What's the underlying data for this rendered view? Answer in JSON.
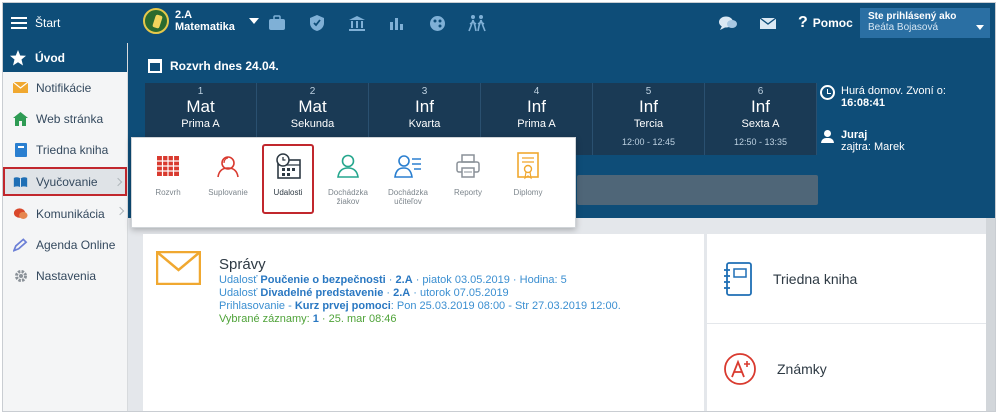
{
  "topbar": {
    "start_label": "Štart",
    "class_name": "2.A",
    "subject_name": "Matematika",
    "help_label": "Pomoc",
    "user_line1": "Ste prihlásený ako",
    "user_line2": "Beáta Bojasová"
  },
  "sidebar": {
    "uvod": "Úvod",
    "items": [
      {
        "label": "Notifikácie",
        "icon": "envelope-icon"
      },
      {
        "label": "Web stránka",
        "icon": "home-icon"
      },
      {
        "label": "Triedna kniha",
        "icon": "book-icon"
      },
      {
        "label": "Vyučovanie",
        "icon": "open-book-icon"
      },
      {
        "label": "Komunikácia",
        "icon": "chat-icon"
      },
      {
        "label": "Agenda Online",
        "icon": "pen-icon"
      },
      {
        "label": "Nastavenia",
        "icon": "gear-icon"
      }
    ]
  },
  "schedule": {
    "title": "Rozvrh dnes 24.04.",
    "periods": [
      {
        "num": "1",
        "subject": "Mat",
        "cls": "Prima A",
        "time": ""
      },
      {
        "num": "2",
        "subject": "Mat",
        "cls": "Sekunda",
        "time": ""
      },
      {
        "num": "3",
        "subject": "Inf",
        "cls": "Kvarta",
        "time": ""
      },
      {
        "num": "4",
        "subject": "Inf",
        "cls": "Prima A",
        "time": ""
      },
      {
        "num": "5",
        "subject": "Inf",
        "cls": "Tercia",
        "time": "12:00 - 12:45"
      },
      {
        "num": "6",
        "subject": "Inf",
        "cls": "Sexta A",
        "time": "12:50 - 13:35"
      }
    ],
    "bell_text": "Hurá domov. Zvoní o:",
    "bell_time": "16:08:41",
    "person_name": "Juraj",
    "person_sub": "zajtra: Marek"
  },
  "dropdown": {
    "items": [
      {
        "label": "Rozvrh",
        "icon": "timetable-icon"
      },
      {
        "label": "Suplovanie",
        "icon": "substitute-icon"
      },
      {
        "label": "Udalosti",
        "icon": "calendar-clock-icon"
      },
      {
        "label": "Dochádzka žiakov",
        "icon": "student-attendance-icon"
      },
      {
        "label": "Dochádzka učiteľov",
        "icon": "teacher-attendance-icon"
      },
      {
        "label": "Reporty",
        "icon": "printer-icon"
      },
      {
        "label": "Diplomy",
        "icon": "diploma-icon"
      }
    ]
  },
  "messages": {
    "title": "Správy",
    "line1_prefix": "Udalosť ",
    "line1_bold": "Poučenie o bezpečnosti",
    "line1_mid": " · ",
    "line1_bold2": "2.A",
    "line1_rest": " · piatok 03.05.2019 · Hodina: 5",
    "line2_prefix": "Udalosť ",
    "line2_bold": "Divadelné predstavenie",
    "line2_mid": " · ",
    "line2_bold2": "2.A",
    "line2_rest": " · utorok 07.05.2019",
    "line3_prefix": "Prihlasovanie - ",
    "line3_bold": "Kurz prvej pomoci",
    "line3_rest": ": Pon 25.03.2019 08:00 - Str 27.03.2019 12:00.",
    "line4_prefix": "Vybrané záznamy: ",
    "line4_bold": "1",
    "line4_rest": " · 25. mar 08:46"
  },
  "cards": {
    "class_book": "Triedna kniha",
    "grades": "Známky"
  },
  "colors": {
    "primary": "#0e4d78",
    "highlight": "#c1272d",
    "link": "#3b8fd1",
    "green": "#4fa339"
  }
}
